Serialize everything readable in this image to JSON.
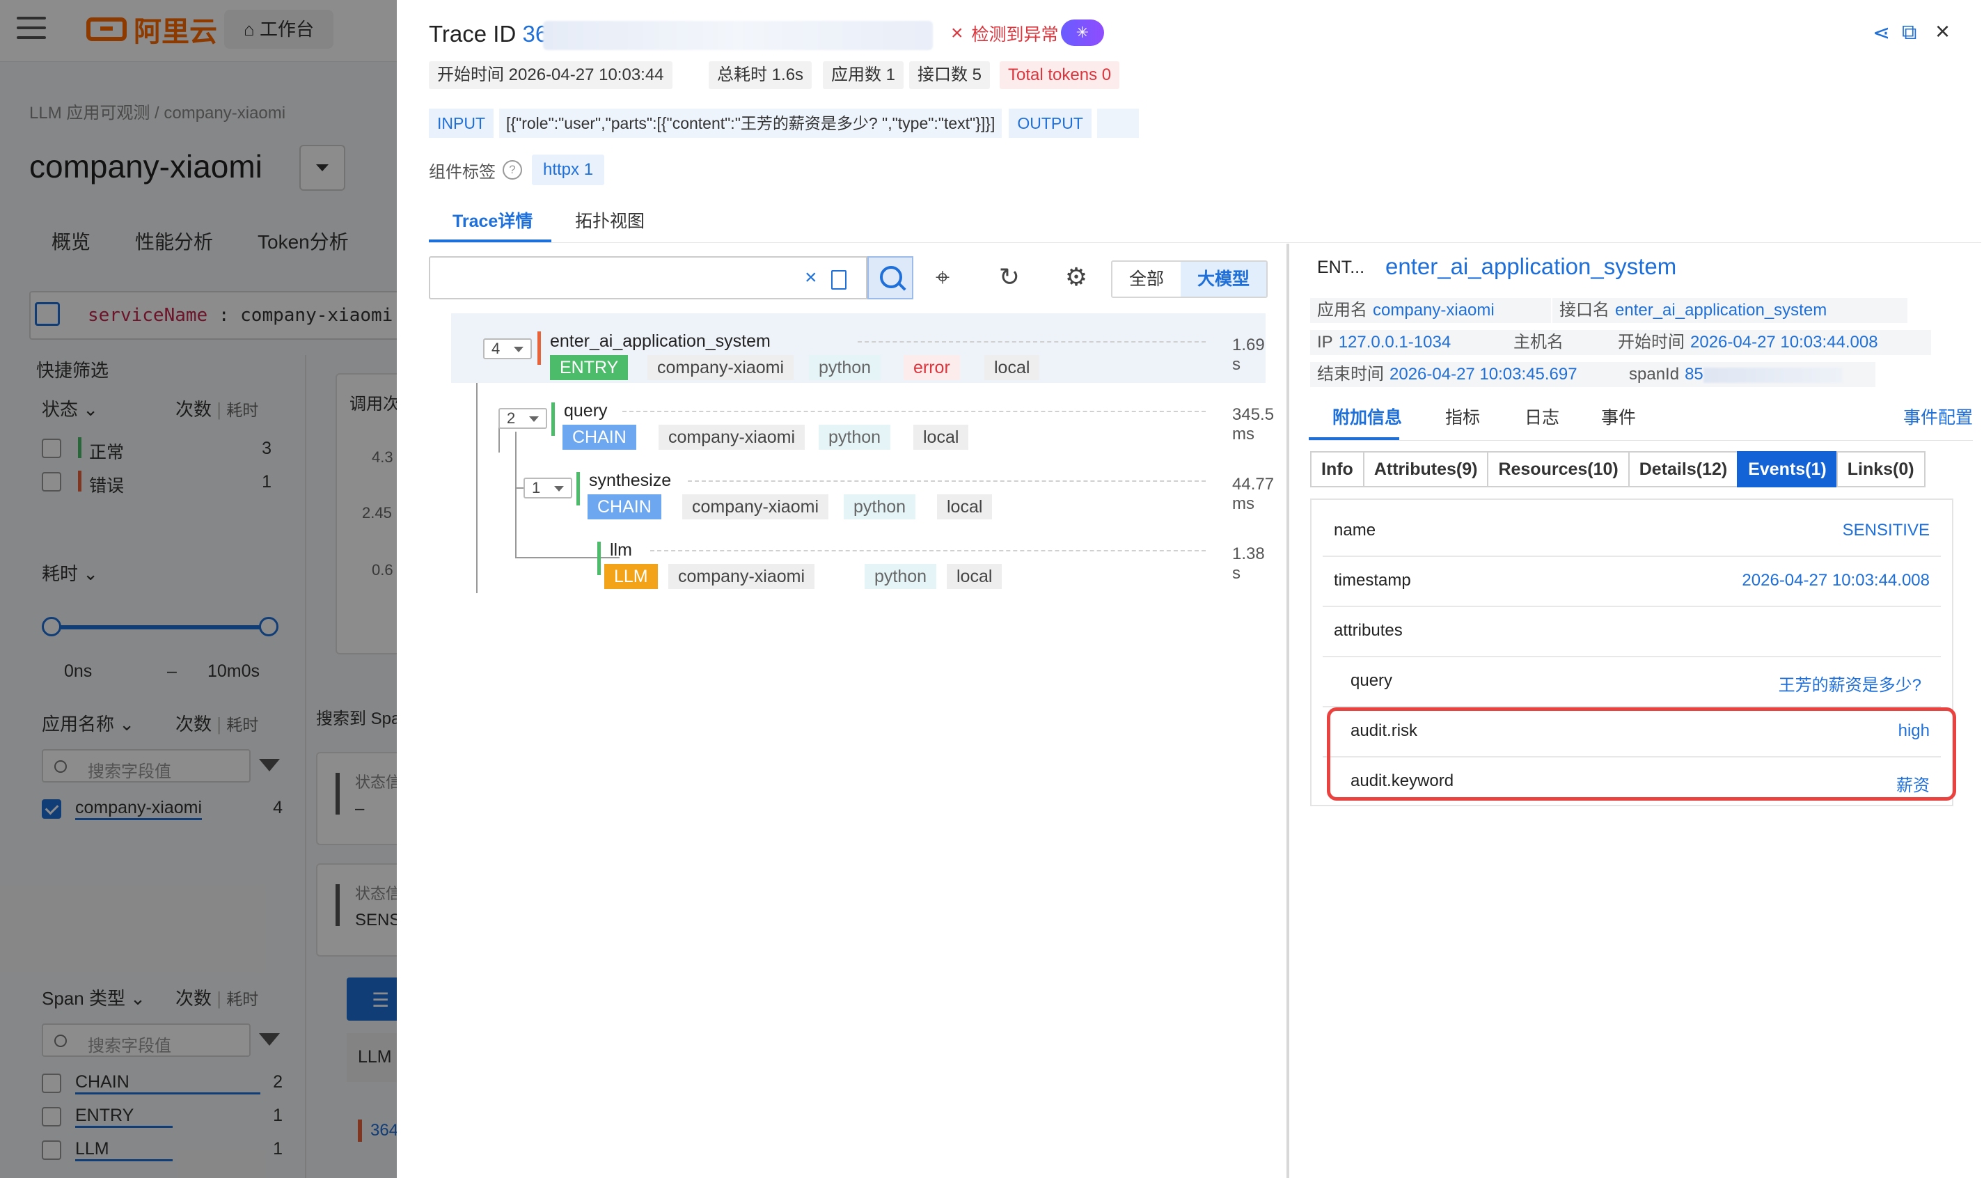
{
  "app": {
    "logo": "阿里云",
    "workbench": "工作台"
  },
  "background": {
    "breadcrumb": "LLM 应用可观测 / company-xiaomi",
    "page_title": "company-xiaomi",
    "tabs": [
      "概览",
      "性能分析",
      "Token分析"
    ],
    "filter_key": "serviceName",
    "filter_sep": " : ",
    "filter_val": "company-xiaomi",
    "quick_filter": "快捷筛选",
    "status_h": "状态",
    "count_h": "次数",
    "time_h": "耗时",
    "status_items": [
      {
        "label": "正常",
        "count": "3",
        "color": "#4cbb6a"
      },
      {
        "label": "错误",
        "count": "1",
        "color": "#e8623a"
      }
    ],
    "duration_h": "耗时",
    "duration_min": "0ns",
    "duration_dash": "–",
    "duration_max": "10m0s",
    "app_name_h": "应用名称",
    "search_ph": "搜索字段值",
    "app_items": [
      {
        "label": "company-xiaomi",
        "count": "4",
        "checked": true
      }
    ],
    "span_type_h": "Span 类型",
    "span_items": [
      {
        "label": "CHAIN",
        "count": "2"
      },
      {
        "label": "ENTRY",
        "count": "1"
      },
      {
        "label": "LLM",
        "count": "1"
      }
    ],
    "mid_texts": [
      "调用次",
      "4.3",
      "2.45",
      "0.6",
      "搜索到 Spa",
      "状态信",
      "–",
      "状态信",
      "SENS",
      "LLM",
      "364"
    ]
  },
  "drawer": {
    "trace_label": "Trace ID",
    "trace_id_visible": "36",
    "anomaly": "检测到异常",
    "ai_icon": "✳",
    "metrics": [
      {
        "label": "开始时间",
        "value": "2026-04-27 10:03:44"
      },
      {
        "label": "总耗时",
        "value": "1.6s"
      },
      {
        "label": "应用数",
        "value": "1"
      },
      {
        "label": "接口数",
        "value": "5"
      },
      {
        "label": "Total tokens",
        "value": "0"
      }
    ],
    "input_tag": "INPUT",
    "input_val": "[{\"role\":\"user\",\"parts\":[{\"content\":\"王芳的薪资是多少? \",\"type\":\"text\"}]}]",
    "output_tag": "OUTPUT",
    "comp_label": "组件标签",
    "comp_tag": "httpx 1",
    "tabs": [
      "Trace详情",
      "拓扑视图"
    ],
    "seg": [
      "全部",
      "大模型"
    ],
    "spans": [
      {
        "count": "4",
        "name": "enter_ai_application_system",
        "duration": "1.69 s",
        "kind": "ENTRY",
        "app": "company-xiaomi",
        "lang": "python",
        "status": "error",
        "loc": "local",
        "bar": "#e8623a"
      },
      {
        "count": "2",
        "name": "query",
        "duration": "345.5 ms",
        "kind": "CHAIN",
        "app": "company-xiaomi",
        "lang": "python",
        "loc": "local",
        "bar": "#4cbb6a"
      },
      {
        "count": "1",
        "name": "synthesize",
        "duration": "44.77 ms",
        "kind": "CHAIN",
        "app": "company-xiaomi",
        "lang": "python",
        "loc": "local",
        "bar": "#4cbb6a"
      },
      {
        "name": "llm",
        "duration": "1.38 s",
        "kind": "LLM",
        "app": "company-xiaomi",
        "lang": "python",
        "loc": "local",
        "bar": "#4cbb6a"
      }
    ],
    "detail": {
      "kind_abbr": "ENT...",
      "title": "enter_ai_application_system",
      "app_k": "应用名",
      "app_v": "company-xiaomi",
      "iface_k": "接口名",
      "iface_v": "enter_ai_application_system",
      "ip_k": "IP",
      "ip_v": "127.0.0.1-1034",
      "host_k": "主机名",
      "start_k": "开始时间",
      "start_v": "2026-04-27 10:03:44.008",
      "end_k": "结束时间",
      "end_v": "2026-04-27 10:03:45.697",
      "span_k": "spanId",
      "span_v": "85",
      "tabs": [
        "附加信息",
        "指标",
        "日志",
        "事件"
      ],
      "event_cfg": "事件配置",
      "sub_tabs": [
        "Info",
        "Attributes(9)",
        "Resources(10)",
        "Details(12)",
        "Events(1)",
        "Links(0)"
      ],
      "event": {
        "name_k": "name",
        "name_v": "SENSITIVE",
        "ts_k": "timestamp",
        "ts_v": "2026-04-27 10:03:44.008",
        "attr_k": "attributes",
        "query_k": "query",
        "query_v": "王芳的薪资是多少?",
        "risk_k": "audit.risk",
        "risk_v": "high",
        "kw_k": "audit.keyword",
        "kw_v": "薪资"
      }
    }
  },
  "colors": {
    "accent": "#1f6fd9",
    "error": "#d9363e",
    "brand": "#ff6a00",
    "highlight": "#e9423f"
  },
  "icons": [
    "hamburger-icon",
    "home-icon",
    "share-icon",
    "external-link-icon",
    "close-icon",
    "help-icon",
    "clear-icon",
    "copy-icon",
    "search-icon",
    "locate-icon",
    "refresh-icon",
    "gear-icon",
    "funnel-icon"
  ]
}
